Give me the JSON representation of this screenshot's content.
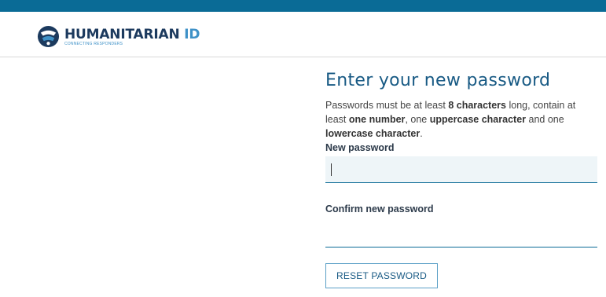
{
  "header": {
    "logo_main": "HUMANITARIAN",
    "logo_id": "ID",
    "logo_tagline": "CONNECTING RESPONDERS"
  },
  "main": {
    "title": "Enter your new password",
    "rules": {
      "p1": "Passwords must be at least ",
      "b1": "8 characters",
      "p2": " long, contain at least ",
      "b2": "one number",
      "p3": ", one ",
      "b3": "uppercase character",
      "p4": " and one ",
      "b4": "lowercase character",
      "p5": "."
    },
    "new_password_label": "New password",
    "new_password_value": "",
    "confirm_password_label": "Confirm new password",
    "confirm_password_value": "",
    "reset_button_label": "RESET PASSWORD"
  },
  "colors": {
    "topbar": "#0a6b96",
    "title": "#185a84",
    "logo_dark": "#1c3a5e",
    "logo_accent": "#3e91c7"
  }
}
